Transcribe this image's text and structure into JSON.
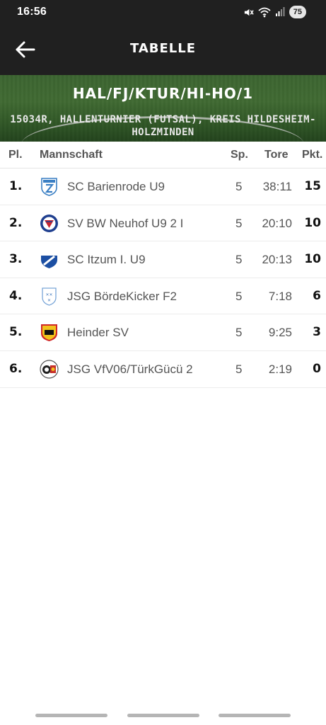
{
  "status_bar": {
    "time": "16:56",
    "battery": "75",
    "icons": [
      "mute-icon",
      "wifi-icon",
      "signal-icon"
    ]
  },
  "app_bar": {
    "title": "TABELLE",
    "back_icon": "arrow-left-icon"
  },
  "banner": {
    "code": "HAL/FJ/KTUR/HI-HO/1",
    "description": "15034R, HALLENTURNIER (FUTSAL), KREIS HILDESHEIM-HOLZMINDEN"
  },
  "table": {
    "headers": {
      "pl": "Pl.",
      "team": "Mannschaft",
      "sp": "Sp.",
      "tore": "Tore",
      "pkt": "Pkt."
    },
    "rows": [
      {
        "pl": "1.",
        "team": "SC Barienrode U9",
        "sp": "5",
        "tore": "38:11",
        "pkt": "15",
        "logo": "sc-barienrode-crest-icon"
      },
      {
        "pl": "2.",
        "team": "SV BW Neuhof U9 2 I",
        "sp": "5",
        "tore": "20:10",
        "pkt": "10",
        "logo": "sv-bw-neuhof-crest-icon"
      },
      {
        "pl": "3.",
        "team": "SC Itzum I. U9",
        "sp": "5",
        "tore": "20:13",
        "pkt": "10",
        "logo": "sc-itzum-crest-icon"
      },
      {
        "pl": "4.",
        "team": "JSG BördeKicker F2",
        "sp": "5",
        "tore": "7:18",
        "pkt": "6",
        "logo": "jsg-boerdekicker-crest-icon"
      },
      {
        "pl": "5.",
        "team": "Heinder SV",
        "sp": "5",
        "tore": "9:25",
        "pkt": "3",
        "logo": "heinder-sv-crest-icon"
      },
      {
        "pl": "6.",
        "team": "JSG VfV06/TürkGücü 2",
        "sp": "5",
        "tore": "2:19",
        "pkt": "0",
        "logo": "jsg-vfv06-crest-icon"
      }
    ]
  },
  "colors": {
    "header_bg": "#202020",
    "text_dark": "#111111",
    "text_muted": "#555555"
  }
}
